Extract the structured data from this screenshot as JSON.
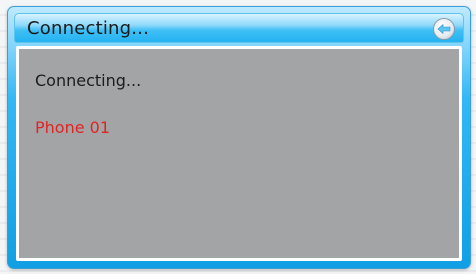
{
  "dialog": {
    "title": "Connecting...",
    "back_icon": "back-arrow-icon"
  },
  "content": {
    "status": "Connecting...",
    "device": "Phone 01"
  },
  "colors": {
    "title_bar": "#33b8f5",
    "panel_bg": "#a3a4a6",
    "device_text": "#e02424"
  }
}
